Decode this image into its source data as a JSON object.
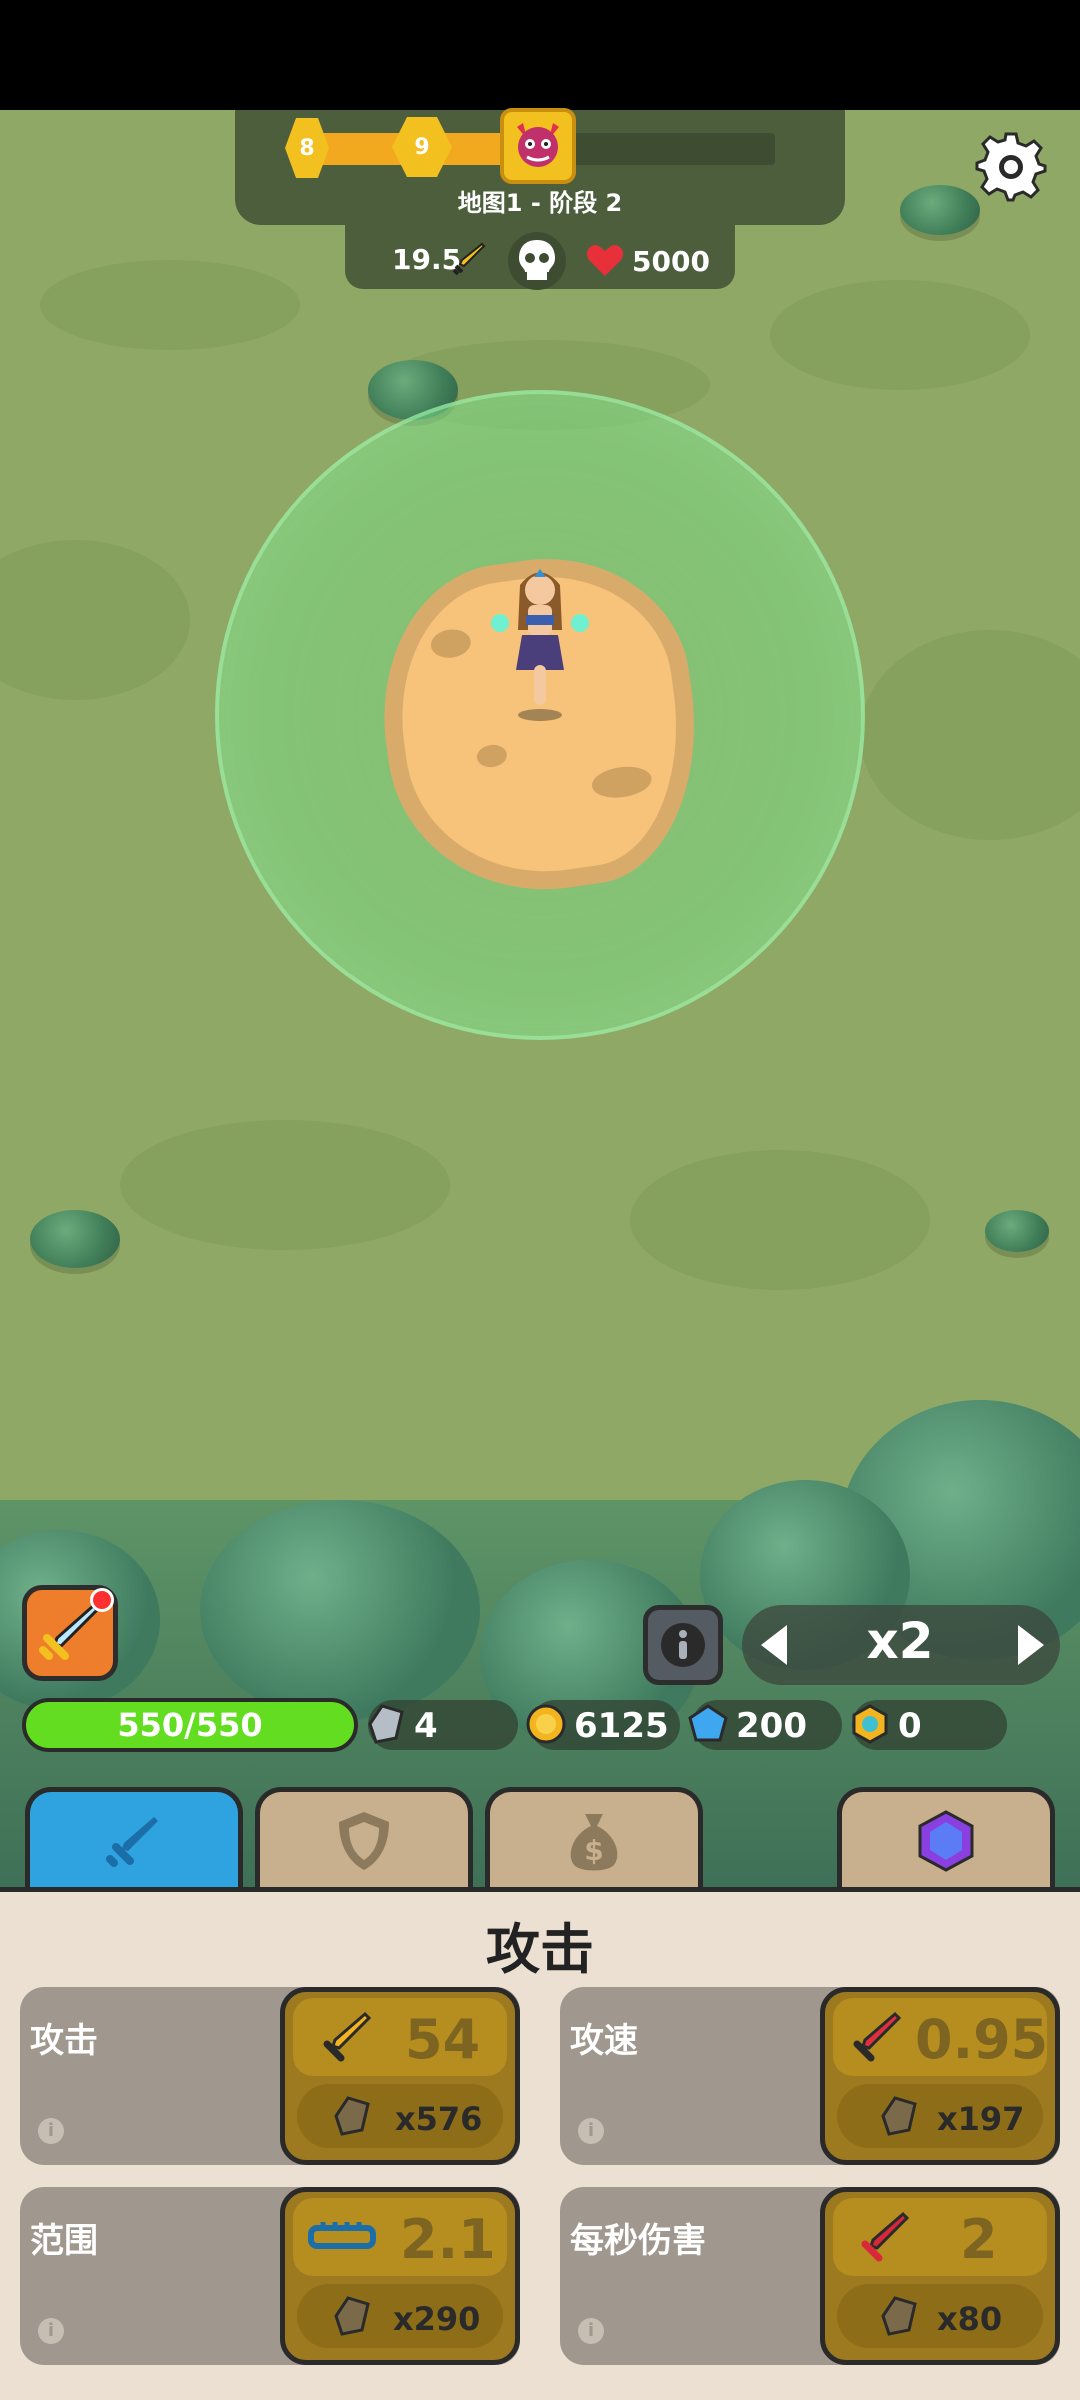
{
  "hud": {
    "left_level": "8",
    "current_level": "9",
    "progress": 0.45,
    "stage_label": "地图1 - 阶段 2",
    "attack_power": "19.5",
    "health": "5000"
  },
  "controls": {
    "speed_label": "x2"
  },
  "resources": {
    "hp": "550/550",
    "stones": "4",
    "gold": "6125",
    "gems": "200",
    "tokens": "0"
  },
  "tabs": [
    {
      "icon": "sword-icon",
      "active": true
    },
    {
      "icon": "shield-icon",
      "active": false
    },
    {
      "icon": "money-bag-icon",
      "active": false
    },
    {
      "icon": "purple-gem-icon",
      "active": false
    }
  ],
  "panel": {
    "title": "攻击",
    "cards": [
      {
        "label": "攻击",
        "value": "54",
        "cost": "x576",
        "icon": "sword-icon"
      },
      {
        "label": "攻速",
        "value": "0.95",
        "cost": "x197",
        "icon": "swift-sword-icon"
      },
      {
        "label": "范围",
        "value": "2.1",
        "cost": "x290",
        "icon": "ruler-icon"
      },
      {
        "label": "每秒伤害",
        "value": "2",
        "cost": "x80",
        "icon": "red-sword-icon"
      }
    ],
    "info_glyph": "i"
  },
  "colors": {
    "accent_tab": "#2fa3df",
    "hp_green": "#62dd20",
    "gold": "#f2c01f"
  }
}
